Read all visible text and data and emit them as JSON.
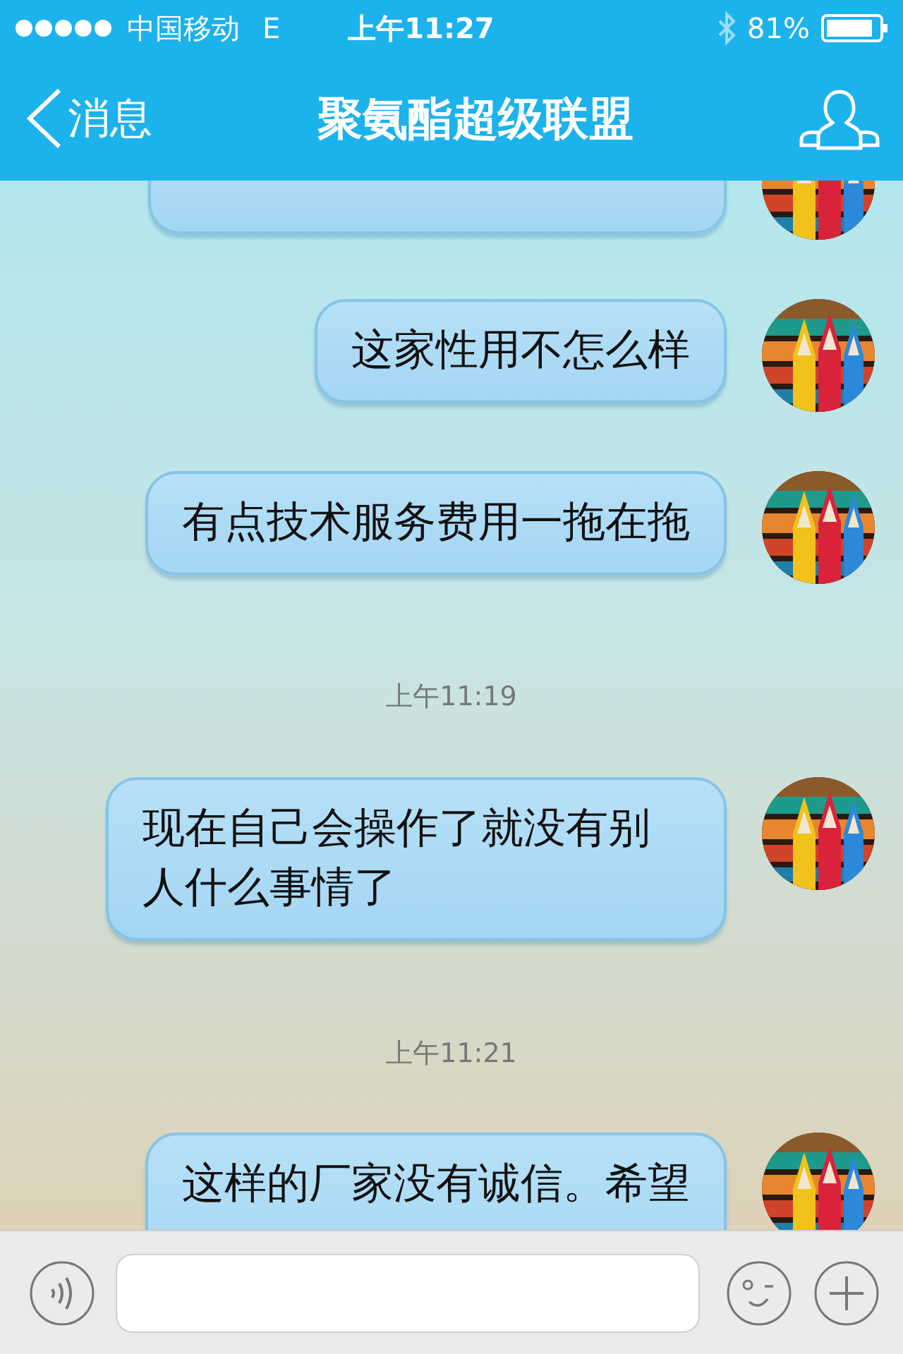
{
  "status_bar": {
    "carrier": "中国移动",
    "network": "E",
    "time": "上午11:27",
    "battery": "81%"
  },
  "nav": {
    "back": "消息",
    "title": "聚氨酯超级联盟"
  },
  "messages": [
    {
      "kind": "message_edge"
    },
    {
      "kind": "message",
      "text": "这家性用不怎么样"
    },
    {
      "kind": "message",
      "text": "有点技术服务费用一拖在拖"
    },
    {
      "kind": "time",
      "text": "上午11:19"
    },
    {
      "kind": "message",
      "text": "现在自己会操作了就没有别人什么事情了"
    },
    {
      "kind": "time",
      "text": "上午11:21"
    },
    {
      "kind": "message_cut",
      "text": "这样的厂家没有诚信。希望"
    }
  ]
}
